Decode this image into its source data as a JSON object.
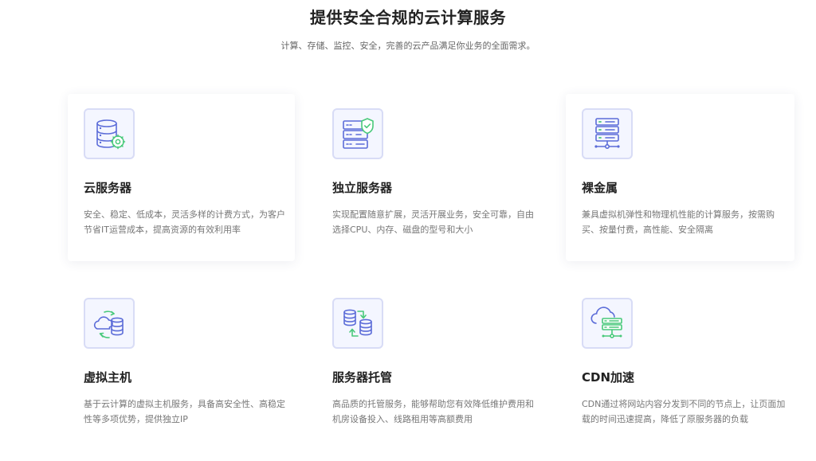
{
  "section": {
    "title": "提供安全合规的云计算服务",
    "subtitle": "计算、存储、监控、安全，完善的云产品满足你业务的全面需求。"
  },
  "colors": {
    "icon_stroke": "#5b6cd8",
    "icon_accent": "#48c97a",
    "icon_box_bg": "#f4f6ff",
    "icon_box_border": "#d8dcf6"
  },
  "services": [
    {
      "icon": "server-database-gear-icon",
      "title": "云服务器",
      "desc": "安全、稳定、低成本，灵活多样的计费方式，为客户节省IT运营成本，提高资源的有效利用率"
    },
    {
      "icon": "server-shield-icon",
      "title": "独立服务器",
      "desc": "实现配置随意扩展，灵活开展业务，安全可靠，自由选择CPU、内存、磁盘的型号和大小"
    },
    {
      "icon": "bare-metal-server-icon",
      "title": "裸金属",
      "desc": "兼具虚拟机弹性和物理机性能的计算服务，按需购买、按量付费，高性能、安全隔离"
    },
    {
      "icon": "cloud-sync-database-icon",
      "title": "虚拟主机",
      "desc": "基于云计算的虚拟主机服务，具备高安全性、高稳定性等多项优势，提供独立IP"
    },
    {
      "icon": "database-transfer-icon",
      "title": "服务器托管",
      "desc": "高品质的托管服务，能够帮助您有效降低维护费用和机房设备投入、线路租用等高额费用"
    },
    {
      "icon": "cloud-server-network-icon",
      "title": "CDN加速",
      "desc": "CDN通过将网站内容分发到不同的节点上，让页面加载的时间迅速提高，降低了原服务器的负载"
    }
  ]
}
